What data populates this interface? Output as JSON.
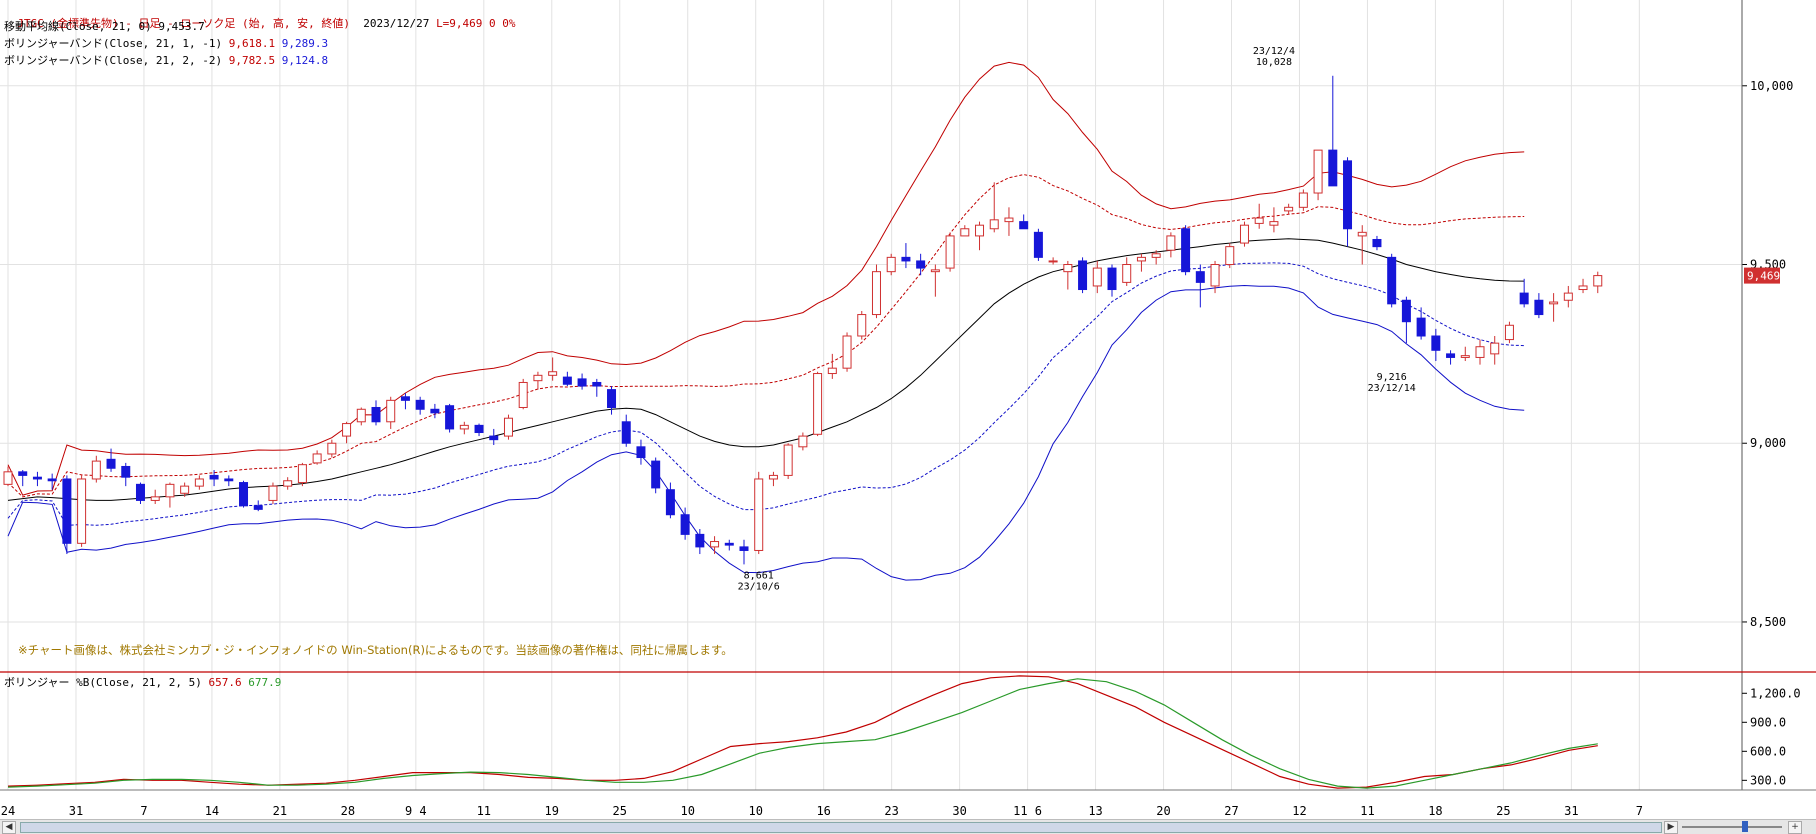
{
  "header": {
    "title": "JTGC (金標準先物) - 日足 - ローソク足 (始, 高, 安, 終値)",
    "date": "2023/12/27",
    "last": "L=9,469",
    "change": "0",
    "pct": "0%",
    "ma_label": "移動平均線(Close, 21, 0)",
    "ma_value": "9,453.7",
    "bb1_label": "ボリンジャーバンド(Close, 21, 1, -1)",
    "bb1_upper": "9,618.1",
    "bb1_lower": "9,289.3",
    "bb2_label": "ボリンジャーバンド(Close, 21, 2, -2)",
    "bb2_upper": "9,782.5",
    "bb2_lower": "9,124.8"
  },
  "copyright": "※チャート画像は、株式会社ミンカブ・ジ・インフォノイドの Win-Station(R)によるものです。当該画像の著作権は、同社に帰属します。",
  "sub_panel": {
    "label": "ボリンジャー %B(Close, 21, 2, 5)",
    "value1": "657.6",
    "value2": "677.9"
  },
  "colors": {
    "up": "#d03030",
    "down": "#1616d8",
    "ma": "#000000",
    "band_upper": "#c00000",
    "band_lower": "#1010c8",
    "pctb_fast": "#c00000",
    "pctb_slow": "#2a9a2a",
    "pctb_third": "#1010c8",
    "grid": "#e2e2e2",
    "panel_sep": "#c00000"
  },
  "scrollbar": {
    "left_icon": "triangle-left-icon",
    "right_icon": "triangle-right-icon"
  },
  "chart_data": [
    {
      "type": "candlestick",
      "ylim": [
        8360,
        10240
      ],
      "yticks": [
        "8,500",
        "9,000",
        "9,500",
        "10,000"
      ],
      "last_price_label": "9,469",
      "x_tick_labels": [
        "24",
        "31",
        "7",
        "14",
        "21",
        "28",
        "9 4",
        "11",
        "19",
        "25",
        "10",
        "10",
        "16",
        "23",
        "30",
        "11 6",
        "13",
        "20",
        "27",
        "12",
        "11",
        "18",
        "25",
        "31",
        "7"
      ],
      "annotations": [
        {
          "text1": "23/12/4",
          "text2": "10,028",
          "x_index": 86,
          "y": 10028,
          "pos": "above"
        },
        {
          "text1": "8,661",
          "text2": "23/10/6",
          "x_index": 51,
          "y": 8661,
          "pos": "below"
        },
        {
          "text1": "9,216",
          "text2": "23/12/14",
          "x_index": 94,
          "y": 9216,
          "pos": "below"
        }
      ],
      "ohlc": [
        [
          8885,
          8935,
          8880,
          8920
        ],
        [
          8920,
          8925,
          8880,
          8910
        ],
        [
          8905,
          8920,
          8880,
          8900
        ],
        [
          8900,
          8915,
          8870,
          8895
        ],
        [
          8900,
          8910,
          8690,
          8720
        ],
        [
          8720,
          8910,
          8710,
          8900
        ],
        [
          8900,
          8965,
          8890,
          8950
        ],
        [
          8955,
          8985,
          8920,
          8930
        ],
        [
          8935,
          8945,
          8880,
          8905
        ],
        [
          8885,
          8890,
          8830,
          8840
        ],
        [
          8840,
          8870,
          8830,
          8850
        ],
        [
          8850,
          8890,
          8820,
          8885
        ],
        [
          8860,
          8890,
          8850,
          8880
        ],
        [
          8880,
          8910,
          8870,
          8900
        ],
        [
          8910,
          8925,
          8880,
          8900
        ],
        [
          8900,
          8910,
          8880,
          8895
        ],
        [
          8890,
          8895,
          8820,
          8825
        ],
        [
          8825,
          8840,
          8810,
          8815
        ],
        [
          8840,
          8890,
          8830,
          8880
        ],
        [
          8880,
          8905,
          8870,
          8895
        ],
        [
          8890,
          8945,
          8880,
          8940
        ],
        [
          8945,
          8980,
          8940,
          8970
        ],
        [
          8970,
          9010,
          8960,
          9000
        ],
        [
          9020,
          9060,
          9000,
          9055
        ],
        [
          9060,
          9100,
          9050,
          9095
        ],
        [
          9100,
          9120,
          9050,
          9060
        ],
        [
          9060,
          9130,
          9040,
          9120
        ],
        [
          9130,
          9140,
          9095,
          9120
        ],
        [
          9120,
          9130,
          9080,
          9095
        ],
        [
          9095,
          9110,
          9070,
          9085
        ],
        [
          9105,
          9110,
          9030,
          9040
        ],
        [
          9040,
          9060,
          9025,
          9050
        ],
        [
          9050,
          9055,
          9020,
          9030
        ],
        [
          9020,
          9040,
          8995,
          9010
        ],
        [
          9020,
          9080,
          9010,
          9070
        ],
        [
          9100,
          9180,
          9095,
          9170
        ],
        [
          9175,
          9200,
          9150,
          9190
        ],
        [
          9190,
          9240,
          9175,
          9200
        ],
        [
          9185,
          9200,
          9160,
          9165
        ],
        [
          9180,
          9195,
          9150,
          9160
        ],
        [
          9170,
          9180,
          9130,
          9160
        ],
        [
          9150,
          9160,
          9080,
          9100
        ],
        [
          9060,
          9080,
          8990,
          9000
        ],
        [
          8990,
          9010,
          8940,
          8960
        ],
        [
          8950,
          8960,
          8860,
          8875
        ],
        [
          8870,
          8890,
          8790,
          8800
        ],
        [
          8800,
          8820,
          8730,
          8745
        ],
        [
          8745,
          8760,
          8690,
          8710
        ],
        [
          8710,
          8740,
          8690,
          8725
        ],
        [
          8720,
          8730,
          8700,
          8715
        ],
        [
          8710,
          8730,
          8661,
          8700
        ],
        [
          8700,
          8920,
          8690,
          8900
        ],
        [
          8900,
          8920,
          8880,
          8910
        ],
        [
          8910,
          9000,
          8900,
          8995
        ],
        [
          8990,
          9030,
          8980,
          9020
        ],
        [
          9025,
          9200,
          9020,
          9195
        ],
        [
          9195,
          9250,
          9180,
          9210
        ],
        [
          9210,
          9310,
          9200,
          9300
        ],
        [
          9300,
          9370,
          9290,
          9360
        ],
        [
          9360,
          9500,
          9350,
          9480
        ],
        [
          9480,
          9530,
          9470,
          9520
        ],
        [
          9520,
          9560,
          9490,
          9510
        ],
        [
          9510,
          9530,
          9470,
          9490
        ],
        [
          9480,
          9500,
          9410,
          9485
        ],
        [
          9490,
          9590,
          9480,
          9580
        ],
        [
          9580,
          9610,
          9580,
          9600
        ],
        [
          9580,
          9620,
          9540,
          9610
        ],
        [
          9600,
          9730,
          9590,
          9625
        ],
        [
          9620,
          9660,
          9580,
          9630
        ],
        [
          9620,
          9640,
          9600,
          9600
        ],
        [
          9590,
          9600,
          9510,
          9520
        ],
        [
          9510,
          9520,
          9500,
          9510
        ],
        [
          9480,
          9510,
          9430,
          9500
        ],
        [
          9510,
          9520,
          9420,
          9430
        ],
        [
          9440,
          9510,
          9420,
          9490
        ],
        [
          9490,
          9500,
          9410,
          9430
        ],
        [
          9450,
          9520,
          9440,
          9500
        ],
        [
          9510,
          9530,
          9480,
          9520
        ],
        [
          9520,
          9540,
          9500,
          9530
        ],
        [
          9540,
          9590,
          9520,
          9580
        ],
        [
          9600,
          9610,
          9470,
          9480
        ],
        [
          9480,
          9500,
          9380,
          9450
        ],
        [
          9440,
          9510,
          9420,
          9500
        ],
        [
          9500,
          9560,
          9490,
          9550
        ],
        [
          9560,
          9620,
          9550,
          9610
        ],
        [
          9615,
          9670,
          9600,
          9630
        ],
        [
          9610,
          9660,
          9590,
          9620
        ],
        [
          9650,
          9670,
          9640,
          9660
        ],
        [
          9660,
          9710,
          9650,
          9700
        ],
        [
          9700,
          9740,
          9680,
          9820
        ],
        [
          9820,
          10028,
          9820,
          9720
        ],
        [
          9790,
          9800,
          9550,
          9600
        ],
        [
          9580,
          9610,
          9500,
          9590
        ],
        [
          9570,
          9580,
          9540,
          9550
        ],
        [
          9520,
          9530,
          9380,
          9390
        ],
        [
          9400,
          9410,
          9280,
          9340
        ],
        [
          9350,
          9380,
          9290,
          9300
        ],
        [
          9300,
          9320,
          9230,
          9260
        ],
        [
          9250,
          9260,
          9220,
          9240
        ],
        [
          9240,
          9270,
          9230,
          9245
        ],
        [
          9240,
          9290,
          9220,
          9270
        ],
        [
          9250,
          9300,
          9220,
          9280
        ],
        [
          9290,
          9340,
          9280,
          9330
        ],
        [
          9420,
          9460,
          9380,
          9390
        ],
        [
          9400,
          9420,
          9350,
          9360
        ],
        [
          9390,
          9420,
          9340,
          9395
        ],
        [
          9400,
          9440,
          9380,
          9420
        ],
        [
          9430,
          9460,
          9420,
          9440
        ],
        [
          9440,
          9480,
          9420,
          9469
        ]
      ],
      "ma": [
        8840,
        8845,
        8850,
        8848,
        8845,
        8842,
        8840,
        8840,
        8843,
        8846,
        8849,
        8852,
        8855,
        8860,
        8866,
        8872,
        8876,
        8878,
        8880,
        8883,
        8887,
        8893,
        8900,
        8910,
        8920,
        8930,
        8940,
        8952,
        8965,
        8978,
        8990,
        9000,
        9010,
        9020,
        9030,
        9040,
        9050,
        9060,
        9070,
        9080,
        9090,
        9095,
        9098,
        9095,
        9080,
        9060,
        9040,
        9020,
        9005,
        8995,
        8990,
        8990,
        8995,
        9005,
        9015,
        9030,
        9045,
        9060,
        9080,
        9100,
        9125,
        9155,
        9190,
        9230,
        9270,
        9310,
        9350,
        9390,
        9420,
        9445,
        9465,
        9480,
        9490,
        9500,
        9510,
        9518,
        9525,
        9530,
        9535,
        9540,
        9545,
        9550,
        9556,
        9560,
        9565,
        9568,
        9570,
        9572,
        9570,
        9568,
        9560,
        9550,
        9540,
        9528,
        9515,
        9500,
        9490,
        9480,
        9472,
        9465,
        9460,
        9456,
        9454,
        9453.7
      ]
    },
    {
      "type": "line",
      "title": "ボリンジャー %B(Close, 21, 2, 5)",
      "ylim": [
        200,
        1420
      ],
      "yticks": [
        "300.0",
        "600.0",
        "900.0",
        "1,200.0"
      ],
      "series": [
        {
          "name": "657.6",
          "values": [
            240,
            250,
            265,
            280,
            310,
            300,
            300,
            280,
            260,
            250,
            260,
            270,
            300,
            340,
            380,
            380,
            380,
            360,
            330,
            320,
            300,
            300,
            320,
            390,
            520,
            650,
            680,
            700,
            740,
            800,
            900,
            1050,
            1180,
            1300,
            1360,
            1380,
            1370,
            1300,
            1180,
            1060,
            900,
            760,
            620,
            480,
            340,
            260,
            220,
            230,
            280,
            340,
            360,
            420,
            460,
            530,
            610,
            657.6
          ]
        },
        {
          "name": "677.9",
          "values": [
            230,
            240,
            255,
            270,
            300,
            310,
            310,
            300,
            280,
            250,
            250,
            260,
            280,
            320,
            350,
            370,
            385,
            380,
            360,
            330,
            300,
            280,
            280,
            300,
            360,
            470,
            580,
            640,
            680,
            700,
            720,
            800,
            900,
            1000,
            1120,
            1240,
            1300,
            1350,
            1320,
            1220,
            1080,
            900,
            720,
            560,
            420,
            310,
            240,
            220,
            240,
            300,
            360,
            420,
            480,
            560,
            630,
            677.9
          ]
        }
      ]
    }
  ]
}
